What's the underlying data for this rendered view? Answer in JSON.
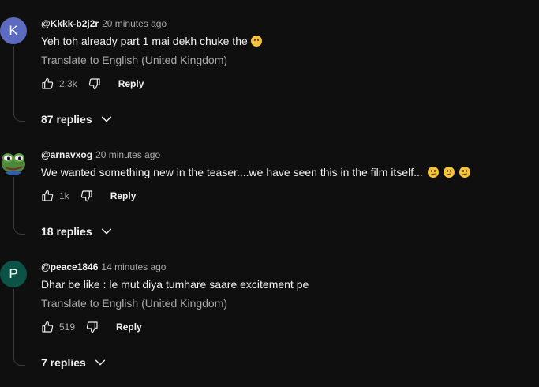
{
  "colors": {
    "background": "#0f0f0f",
    "avatar_k": "#5c6bc0",
    "avatar_p": "#0b5347",
    "text_primary": "#f1f1f1",
    "text_secondary": "#aaaaaa"
  },
  "comments": [
    {
      "avatar_letter": "K",
      "author": "@Kkkk-b2j2r",
      "time": "20 minutes ago",
      "text": "Yeh toh already part 1 mai dekh chuke the",
      "translate": "Translate to English (United Kingdom)",
      "likes": "2.3k",
      "reply_label": "Reply",
      "replies_label": "87 replies",
      "emoji": "sad-face-emoji"
    },
    {
      "avatar_letter": "",
      "avatar_icon": "pepe-frog-avatar",
      "author": "@arnavxog",
      "time": "20 minutes ago",
      "text": "We wanted something new in the teaser....we have seen this in the film itself...",
      "likes": "1k",
      "reply_label": "Reply",
      "replies_label": "18 replies",
      "emoji": "confused-face-emoji"
    },
    {
      "avatar_letter": "P",
      "author": "@peace1846",
      "time": "14 minutes ago",
      "text": "Dhar be like : le mut diya tumhare saare excitement pe",
      "translate": "Translate to English (United Kingdom)",
      "likes": "519",
      "reply_label": "Reply",
      "replies_label": "7 replies"
    }
  ]
}
